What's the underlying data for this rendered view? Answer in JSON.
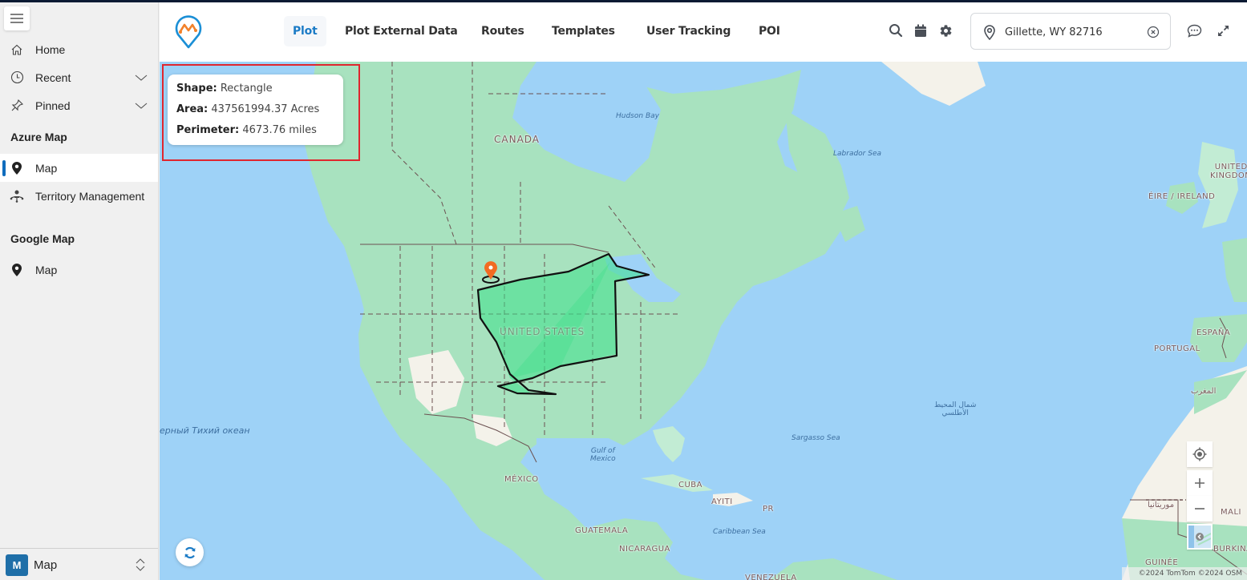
{
  "sidebar": {
    "menu_icon": "hamburger-icon",
    "items": [
      {
        "label": "Home",
        "icon": "home-icon"
      },
      {
        "label": "Recent",
        "icon": "clock-icon",
        "expandable": true
      },
      {
        "label": "Pinned",
        "icon": "pin-icon",
        "expandable": true
      }
    ],
    "sections": [
      {
        "title": "Azure Map",
        "items": [
          {
            "label": "Map",
            "icon": "map-marker-icon",
            "active": true
          },
          {
            "label": "Territory Management",
            "icon": "territory-icon"
          }
        ]
      },
      {
        "title": "Google Map",
        "items": [
          {
            "label": "Map",
            "icon": "map-marker-icon"
          }
        ]
      }
    ],
    "footer": {
      "badge": "M",
      "app_name": "Map"
    }
  },
  "header": {
    "tabs": [
      {
        "label": "Plot",
        "active": true
      },
      {
        "label": "Plot External Data"
      },
      {
        "label": "Routes"
      },
      {
        "label": "Templates"
      },
      {
        "label": "User Tracking"
      },
      {
        "label": "POI"
      }
    ],
    "icons": [
      "search-icon",
      "calendar-icon",
      "gear-icon"
    ],
    "location_search": {
      "value": "Gillette, WY 82716",
      "placeholder": ""
    },
    "right_icons": [
      "chat-icon",
      "expand-icon"
    ]
  },
  "map": {
    "shape_info": {
      "shape_label": "Shape:",
      "shape_value": "Rectangle",
      "area_label": "Area:",
      "area_value": "437561994.37 Acres",
      "perimeter_label": "Perimeter:",
      "perimeter_value": "4673.76 miles"
    },
    "labels": {
      "canada": "CANADA",
      "united_states": "UNITED STATES",
      "mexico": "MÉXICO",
      "cuba": "CUBA",
      "ayiti": "AYITI",
      "pr": "PR",
      "guatemala": "GUATEMALA",
      "nicaragua": "NICARAGUA",
      "venezuela": "VENEZUELA",
      "hudson_bay": "Hudson Bay",
      "labrador_sea": "Labrador Sea",
      "gulf_of_mexico_1": "Gulf of",
      "gulf_of_mexico_2": "Mexico",
      "caribbean_sea": "Caribbean Sea",
      "sargasso_sea": "Sargasso Sea",
      "pacific_ocean": "ерный Тихий океан",
      "atlantic_1": "شمال المحيط",
      "atlantic_2": "الأطلسي",
      "united_kingdom_1": "UNITED",
      "united_kingdom_2": "KINGDOM",
      "ireland": "ÉIRE / IRELAND",
      "espana": "ESPAÑA",
      "portugal": "PORTUGAL",
      "morocco": "المغرب",
      "mauritania": "موريتانيا",
      "mali": "MALI",
      "guinee": "GUINÉE",
      "burkina": "BURKINA FA"
    },
    "controls": [
      "locate-icon",
      "zoom-in-icon",
      "zoom-out-icon",
      "map-style-icon"
    ],
    "attribution": "©2024 TomTom  ©2024 OSM",
    "colors": {
      "water": "#9ed2f7",
      "land": "#a8e2bf",
      "polygon_fill": "#3de08a",
      "highlight": "#e0262e",
      "marker": "#f26b22"
    }
  }
}
